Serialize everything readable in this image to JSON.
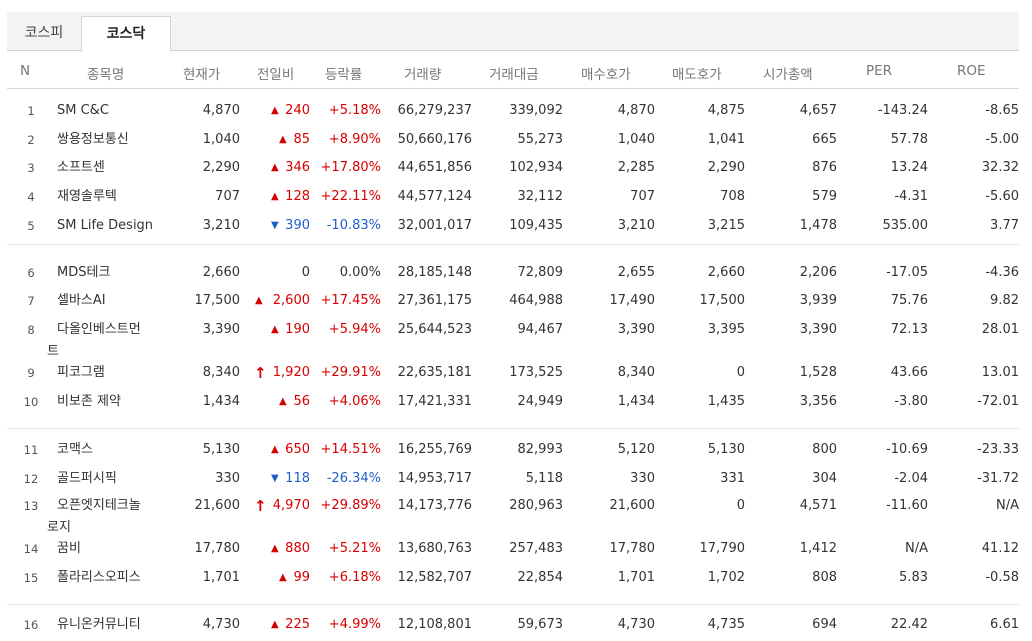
{
  "tabs": [
    {
      "label": "코스피",
      "active": false
    },
    {
      "label": "코스닥",
      "active": true
    }
  ],
  "headers": {
    "n": "N",
    "name": "종목명",
    "cur": "현재가",
    "chg": "전일비",
    "pct": "등락률",
    "vol": "거래량",
    "amt": "거래대금",
    "bid": "매수호가",
    "ask": "매도호가",
    "cap": "시가총액",
    "per": "PER",
    "roe": "ROE"
  },
  "rows": [
    {
      "n": "1",
      "name": "SM C&C",
      "name2": "",
      "cur": "4,870",
      "dir": "up",
      "arrow": "▲",
      "chg": "240",
      "pct": "+5.18%",
      "vol": "66,279,237",
      "amt": "339,092",
      "bid": "4,870",
      "ask": "4,875",
      "cap": "4,657",
      "per": "-143.24",
      "roe": "-8.65"
    },
    {
      "n": "2",
      "name": "쌍용정보통신",
      "name2": "",
      "cur": "1,040",
      "dir": "up",
      "arrow": "▲",
      "chg": "85",
      "pct": "+8.90%",
      "vol": "50,660,176",
      "amt": "55,273",
      "bid": "1,040",
      "ask": "1,041",
      "cap": "665",
      "per": "57.78",
      "roe": "-5.00"
    },
    {
      "n": "3",
      "name": "소프트센",
      "name2": "",
      "cur": "2,290",
      "dir": "up",
      "arrow": "▲",
      "chg": "346",
      "pct": "+17.80%",
      "vol": "44,651,856",
      "amt": "102,934",
      "bid": "2,285",
      "ask": "2,290",
      "cap": "876",
      "per": "13.24",
      "roe": "32.32"
    },
    {
      "n": "4",
      "name": "재영솔루텍",
      "name2": "",
      "cur": "707",
      "dir": "up",
      "arrow": "▲",
      "chg": "128",
      "pct": "+22.11%",
      "vol": "44,577,124",
      "amt": "32,112",
      "bid": "707",
      "ask": "708",
      "cap": "579",
      "per": "-4.31",
      "roe": "-5.60"
    },
    {
      "n": "5",
      "name": "SM Life Design",
      "name2": "",
      "cur": "3,210",
      "dir": "down",
      "arrow": "▼",
      "chg": "390",
      "pct": "-10.83%",
      "vol": "32,001,017",
      "amt": "109,435",
      "bid": "3,210",
      "ask": "3,215",
      "cap": "1,478",
      "per": "535.00",
      "roe": "3.77"
    },
    {
      "n": "6",
      "name": "MDS테크",
      "name2": "",
      "cur": "2,660",
      "dir": "flat",
      "arrow": "",
      "chg": "0",
      "pct": "0.00%",
      "vol": "28,185,148",
      "amt": "72,809",
      "bid": "2,655",
      "ask": "2,660",
      "cap": "2,206",
      "per": "-17.05",
      "roe": "-4.36"
    },
    {
      "n": "7",
      "name": "셀바스AI",
      "name2": "",
      "cur": "17,500",
      "dir": "up",
      "arrow": "▲",
      "chg": "2,600",
      "pct": "+17.45%",
      "vol": "27,361,175",
      "amt": "464,988",
      "bid": "17,490",
      "ask": "17,500",
      "cap": "3,939",
      "per": "75.76",
      "roe": "9.82"
    },
    {
      "n": "8",
      "name": "다올인베스트먼",
      "name2": "트",
      "cur": "3,390",
      "dir": "up",
      "arrow": "▲",
      "chg": "190",
      "pct": "+5.94%",
      "vol": "25,644,523",
      "amt": "94,467",
      "bid": "3,390",
      "ask": "3,395",
      "cap": "3,390",
      "per": "72.13",
      "roe": "28.01"
    },
    {
      "n": "9",
      "name": "피코그램",
      "name2": "",
      "cur": "8,340",
      "dir": "up",
      "arrow": "↑",
      "chg": "1,920",
      "pct": "+29.91%",
      "vol": "22,635,181",
      "amt": "173,525",
      "bid": "8,340",
      "ask": "0",
      "cap": "1,528",
      "per": "43.66",
      "roe": "13.01"
    },
    {
      "n": "10",
      "name": "비보존 제약",
      "name2": "",
      "cur": "1,434",
      "dir": "up",
      "arrow": "▲",
      "chg": "56",
      "pct": "+4.06%",
      "vol": "17,421,331",
      "amt": "24,949",
      "bid": "1,434",
      "ask": "1,435",
      "cap": "3,356",
      "per": "-3.80",
      "roe": "-72.01"
    },
    {
      "n": "11",
      "name": "코맥스",
      "name2": "",
      "cur": "5,130",
      "dir": "up",
      "arrow": "▲",
      "chg": "650",
      "pct": "+14.51%",
      "vol": "16,255,769",
      "amt": "82,993",
      "bid": "5,120",
      "ask": "5,130",
      "cap": "800",
      "per": "-10.69",
      "roe": "-23.33"
    },
    {
      "n": "12",
      "name": "골드퍼시픽",
      "name2": "",
      "cur": "330",
      "dir": "down",
      "arrow": "▼",
      "chg": "118",
      "pct": "-26.34%",
      "vol": "14,953,717",
      "amt": "5,118",
      "bid": "330",
      "ask": "331",
      "cap": "304",
      "per": "-2.04",
      "roe": "-31.72"
    },
    {
      "n": "13",
      "name": "오픈엣지테크놀",
      "name2": "로지",
      "cur": "21,600",
      "dir": "up",
      "arrow": "↑",
      "chg": "4,970",
      "pct": "+29.89%",
      "vol": "14,173,776",
      "amt": "280,963",
      "bid": "21,600",
      "ask": "0",
      "cap": "4,571",
      "per": "-11.60",
      "roe": "N/A"
    },
    {
      "n": "14",
      "name": "꿈비",
      "name2": "",
      "cur": "17,780",
      "dir": "up",
      "arrow": "▲",
      "chg": "880",
      "pct": "+5.21%",
      "vol": "13,680,763",
      "amt": "257,483",
      "bid": "17,780",
      "ask": "17,790",
      "cap": "1,412",
      "per": "N/A",
      "roe": "41.12"
    },
    {
      "n": "15",
      "name": "폴라리스오피스",
      "name2": "",
      "cur": "1,701",
      "dir": "up",
      "arrow": "▲",
      "chg": "99",
      "pct": "+6.18%",
      "vol": "12,582,707",
      "amt": "22,854",
      "bid": "1,701",
      "ask": "1,702",
      "cap": "808",
      "per": "5.83",
      "roe": "-0.58"
    },
    {
      "n": "16",
      "name": "유니온커뮤니티",
      "name2": "",
      "cur": "4,730",
      "dir": "up",
      "arrow": "▲",
      "chg": "225",
      "pct": "+4.99%",
      "vol": "12,108,801",
      "amt": "59,673",
      "bid": "4,730",
      "ask": "4,735",
      "cap": "694",
      "per": "22.42",
      "roe": "6.61"
    }
  ],
  "colors": {
    "up": "#d60000",
    "down": "#1f5fc9"
  }
}
